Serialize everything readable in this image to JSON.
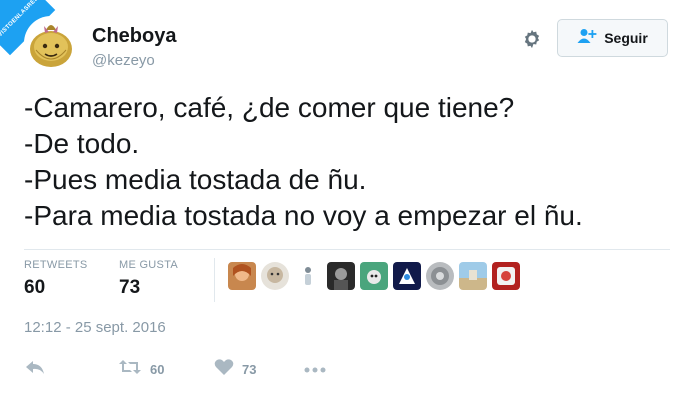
{
  "watermark": {
    "text": "VISTOENLASREDES.com"
  },
  "user": {
    "display_name": "Cheboya",
    "handle": "@kezeyo"
  },
  "header": {
    "follow_label": "Seguir",
    "settings_icon": "gear-icon",
    "follow_icon": "add-user-icon"
  },
  "tweet": {
    "lines": [
      "-Camarero, café, ¿de comer que tiene?",
      "-De todo.",
      "-Pues media tostada de ñu.",
      "-Para media tostada no voy a empezar el ñu."
    ]
  },
  "stats": {
    "retweets_label": "RETWEETS",
    "retweets_value": "60",
    "likes_label": "ME GUSTA",
    "likes_value": "73"
  },
  "likers_count_shown": 9,
  "timestamp": "12:12 - 25 sept. 2016",
  "actions": {
    "reply_icon": "reply-icon",
    "retweet_icon": "retweet-icon",
    "retweet_count": "60",
    "like_icon": "heart-icon",
    "like_count": "73",
    "more_icon": "more-icon"
  },
  "colors": {
    "brand_blue": "#1da1f2",
    "text_primary": "#14171a",
    "text_secondary": "#8899a6",
    "divider": "#e1e8ed"
  }
}
